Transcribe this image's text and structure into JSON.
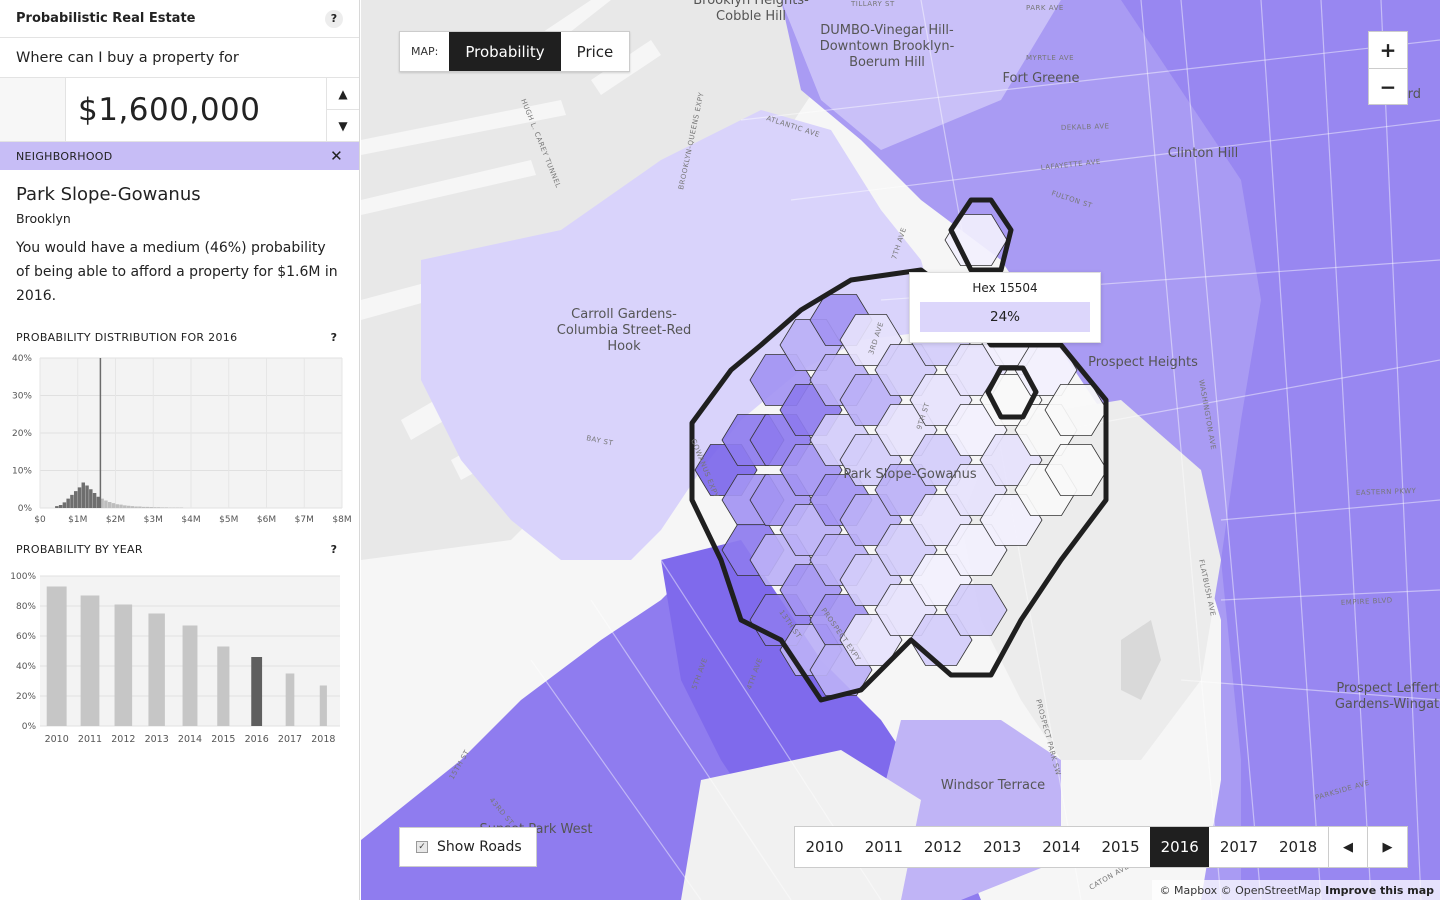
{
  "app": {
    "title": "Probabilistic Real Estate",
    "help": "?"
  },
  "query": {
    "question": "Where can I buy a property for",
    "price": "$1,600,000",
    "up": "▲",
    "down": "▼"
  },
  "neighborhood": {
    "bar_label": "NEIGHBORHOOD",
    "close": "✕",
    "name": "Park Slope-Gowanus",
    "borough": "Brooklyn",
    "description": "You would have a medium (46%) probability of being able to afford a property for $1.6M in 2016."
  },
  "dist_chart": {
    "heading": "PROBABILITY DISTRIBUTION FOR 2016",
    "help": "?"
  },
  "year_chart": {
    "heading": "PROBABILITY BY YEAR",
    "help": "?"
  },
  "chart_data": [
    {
      "type": "bar",
      "title": "PROBABILITY DISTRIBUTION FOR 2016",
      "x_ticks": [
        "$0",
        "$1M",
        "$2M",
        "$3M",
        "$4M",
        "$5M",
        "$6M",
        "$7M",
        "$8M"
      ],
      "y_ticks": [
        "0%",
        "10%",
        "20%",
        "30%",
        "40%"
      ],
      "xlim": [
        0,
        8000000
      ],
      "ylim": [
        0,
        40
      ],
      "bin_width": 100000,
      "bin_start": 400000,
      "values": [
        0.5,
        0.8,
        1.5,
        2.5,
        3.5,
        4.5,
        5.5,
        6.8,
        6.0,
        5.0,
        4.0,
        3.0,
        2.5,
        2.0,
        1.6,
        1.3,
        1.0,
        0.9,
        0.7,
        0.6,
        0.5,
        0.4,
        0.4,
        0.3,
        0.3,
        0.25,
        0.2,
        0.2,
        0.15,
        0.15,
        0.1,
        0.1,
        0.1,
        0.1
      ],
      "marker": 1600000,
      "grid": true
    },
    {
      "type": "bar",
      "title": "PROBABILITY BY YEAR",
      "categories": [
        "2010",
        "2011",
        "2012",
        "2013",
        "2014",
        "2015",
        "2016",
        "2017",
        "2018"
      ],
      "values": [
        93,
        87,
        81,
        75,
        67,
        53,
        46,
        35,
        27
      ],
      "highlight": "2016",
      "y_ticks": [
        "0%",
        "20%",
        "40%",
        "60%",
        "80%",
        "100%"
      ],
      "ylim": [
        0,
        100
      ],
      "grid": true
    }
  ],
  "map": {
    "toggle_label": "MAP:",
    "options": [
      "Probability",
      "Price"
    ],
    "active_option": "Probability",
    "zoom_in": "+",
    "zoom_out": "−",
    "tooltip": {
      "title": "Hex 15504",
      "value": "24%"
    },
    "show_roads": "Show Roads",
    "years": [
      "2010",
      "2011",
      "2012",
      "2013",
      "2014",
      "2015",
      "2016",
      "2017",
      "2018"
    ],
    "active_year": "2016",
    "prev": "◀",
    "next": "▶",
    "attribution": "© Mapbox © OpenStreetMap",
    "improve": "Improve this map",
    "labels": [
      "Brooklyn Heights-",
      "Cobble Hill",
      "DUMBO-Vinegar Hill-",
      "Downtown Brooklyn-",
      "Boerum Hill",
      "Fort Greene",
      "Clinton Hill",
      "Carroll Gardens-",
      "Columbia Street-Red",
      "Hook",
      "Prospect Heights",
      "Park Slope-Gowanus",
      "Windsor Terrace",
      "Prospect Lefferts",
      "Gardens-Wingate",
      "Sunset Park West",
      "Bedford"
    ],
    "streets": [
      "HUGH L. CAREY TUNNEL",
      "BROOKLYN-QUEENS EXPY",
      "ATLANTIC AVE",
      "BAY ST",
      "DEKALB AVE",
      "LAFAYETTE AVE",
      "FULTON ST",
      "WASHINGTON AVE",
      "FLATBUSH AVE",
      "EASTERN PKWY",
      "EMPIRE BLVD",
      "PARKSIDE AVE",
      "PROSPECT EXPY",
      "5TH AVE",
      "4TH AVE",
      "7TH AVE",
      "9TH ST",
      "3RD AVE",
      "MYRTLE AVE",
      "PARK AVE",
      "TILLARY ST",
      "CATON AVE",
      "PROSPECT PARK SW",
      "43RD ST",
      "13TH ST",
      "GOWANUS EXPY",
      "15TH ST"
    ]
  }
}
